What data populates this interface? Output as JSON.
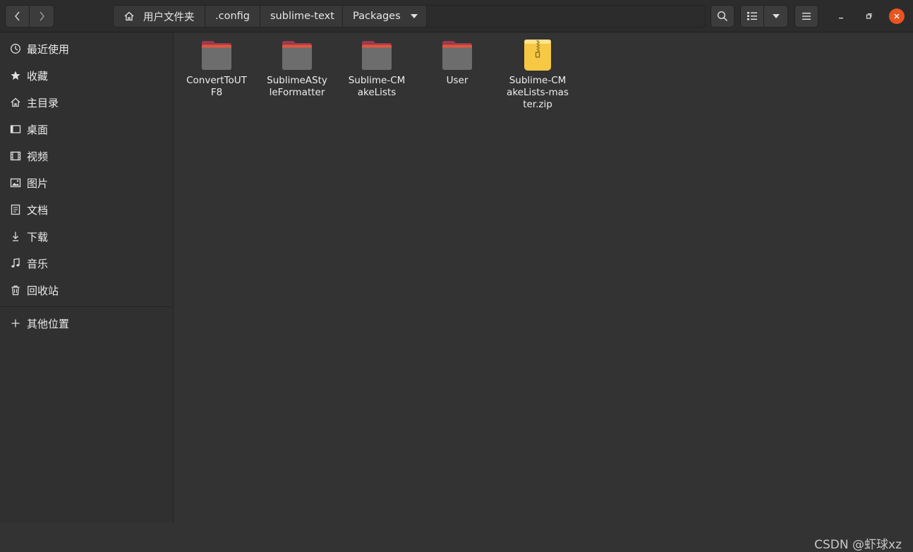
{
  "header": {
    "back_icon": "chevron-left-icon",
    "forward_icon": "chevron-right-icon",
    "breadcrumbs": [
      "用户文件夹",
      ".config",
      "sublime-text",
      "Packages"
    ],
    "search_icon": "search-icon",
    "view_icon": "list-view-icon",
    "menu_icon": "hamburger-menu-icon",
    "close_color": "#e95420"
  },
  "sidebar": {
    "items": [
      {
        "label": "最近使用",
        "icon": "clock-icon"
      },
      {
        "label": "收藏",
        "icon": "star-icon"
      },
      {
        "label": "主目录",
        "icon": "home-icon"
      },
      {
        "label": "桌面",
        "icon": "desktop-icon"
      },
      {
        "label": "视频",
        "icon": "video-icon"
      },
      {
        "label": "图片",
        "icon": "image-icon"
      },
      {
        "label": "文档",
        "icon": "document-icon"
      },
      {
        "label": "下载",
        "icon": "download-icon"
      },
      {
        "label": "音乐",
        "icon": "music-icon"
      },
      {
        "label": "回收站",
        "icon": "trash-icon"
      }
    ],
    "other_locations": {
      "label": "其他位置",
      "icon": "plus-icon"
    }
  },
  "files": [
    {
      "name": "ConvertToUTF8",
      "type": "folder"
    },
    {
      "name": "SublimeAStyleFormatter",
      "type": "folder"
    },
    {
      "name": "Sublime-CMakeLists",
      "type": "folder"
    },
    {
      "name": "User",
      "type": "folder"
    },
    {
      "name": "Sublime-CMakeLists-master.zip",
      "type": "zip"
    }
  ],
  "watermark": "CSDN @虾球xz"
}
